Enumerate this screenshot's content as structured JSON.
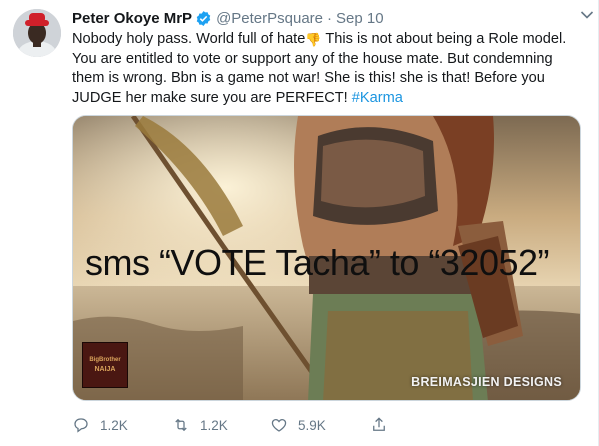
{
  "tweet": {
    "author_name": "Peter Okoye MrP",
    "handle": "@PeterPsquare",
    "separator": "·",
    "date": "Sep 10",
    "text_before_emoji": "Nobody holy pass. World full of hate",
    "emoji": "👎",
    "text_after_emoji": " This is not about being a Role model. You are entitled to vote or support any of the house mate. But condemning them is wrong. Bbn is a game not war! She is this! she is that! Before you JUDGE her make sure you are PERFECT! ",
    "hashtag": "#Karma",
    "media": {
      "overlay_text": "sms “VOTE Tacha” to “32052”",
      "credit": "BREIMASJIEN DESIGNS",
      "badge_line1": "BigBrother",
      "badge_line2": "NAIJA"
    },
    "actions": {
      "reply_count": "1.2K",
      "retweet_count": "1.2K",
      "like_count": "5.9K"
    }
  },
  "colors": {
    "link": "#1b95e0",
    "secondary_text": "#657786",
    "verified": "#1da1f2",
    "avatar_hat": "#d0202a"
  },
  "icons": [
    "verified-badge-icon",
    "chevron-down-icon",
    "reply-icon",
    "retweet-icon",
    "like-icon",
    "share-icon"
  ]
}
